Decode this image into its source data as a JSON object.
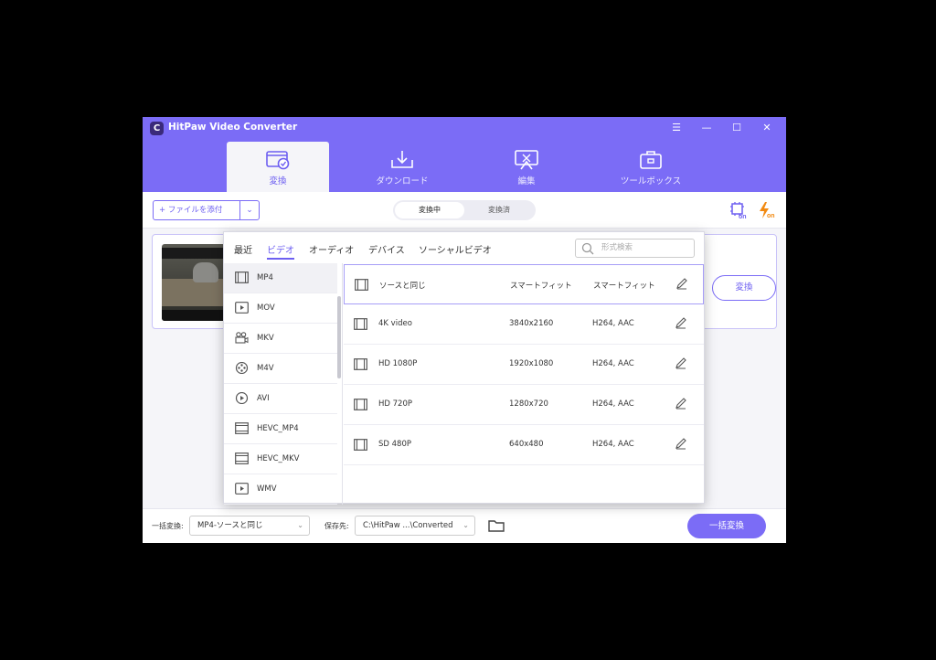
{
  "app": {
    "title": "HitPaw Video Converter",
    "logo_letter": "C"
  },
  "window_controls": {
    "menu": "☰",
    "minimize": "—",
    "maximize": "☐",
    "close": "✕"
  },
  "tabs": [
    {
      "label": "変換",
      "icon": "convert-icon",
      "active": true
    },
    {
      "label": "ダウンロード",
      "icon": "download-icon",
      "active": false
    },
    {
      "label": "編集",
      "icon": "edit-icon",
      "active": false
    },
    {
      "label": "ツールボックス",
      "icon": "toolbox-icon",
      "active": false
    }
  ],
  "toolbar": {
    "add_file_label": "+ ファイルを添付",
    "dropdown_glyph": "⌄",
    "segments": [
      "変換中",
      "変換済"
    ],
    "hw_accel_label": "on",
    "lightning_label": "on"
  },
  "file_card": {
    "convert_label": "変換"
  },
  "format_popup": {
    "categories": [
      "最近",
      "ビデオ",
      "オーディオ",
      "デバイス",
      "ソーシャルビデオ"
    ],
    "active_category": "ビデオ",
    "search_placeholder": "形式検索",
    "formats": [
      "MP4",
      "MOV",
      "MKV",
      "M4V",
      "AVI",
      "HEVC_MP4",
      "HEVC_MKV",
      "WMV"
    ],
    "selected_format": "MP4",
    "presets": [
      {
        "name": "ソースと同じ",
        "resolution": "スマートフィット",
        "codec": "スマートフィット"
      },
      {
        "name": "4K video",
        "resolution": "3840x2160",
        "codec": "H264, AAC"
      },
      {
        "name": "HD 1080P",
        "resolution": "1920x1080",
        "codec": "H264, AAC"
      },
      {
        "name": "HD 720P",
        "resolution": "1280x720",
        "codec": "H264, AAC"
      },
      {
        "name": "SD 480P",
        "resolution": "640x480",
        "codec": "H264, AAC"
      }
    ]
  },
  "bottom_bar": {
    "batch_label": "一括変換:",
    "batch_value": "MP4-ソースと同じ",
    "save_label": "保存先:",
    "save_value": "C:\\HitPaw ...\\Converted",
    "caret": "⌄",
    "batch_button": "一括変換"
  },
  "colors": {
    "accent": "#7b6cf6",
    "accent_dark": "#6d5ff1",
    "background": "#000000"
  }
}
